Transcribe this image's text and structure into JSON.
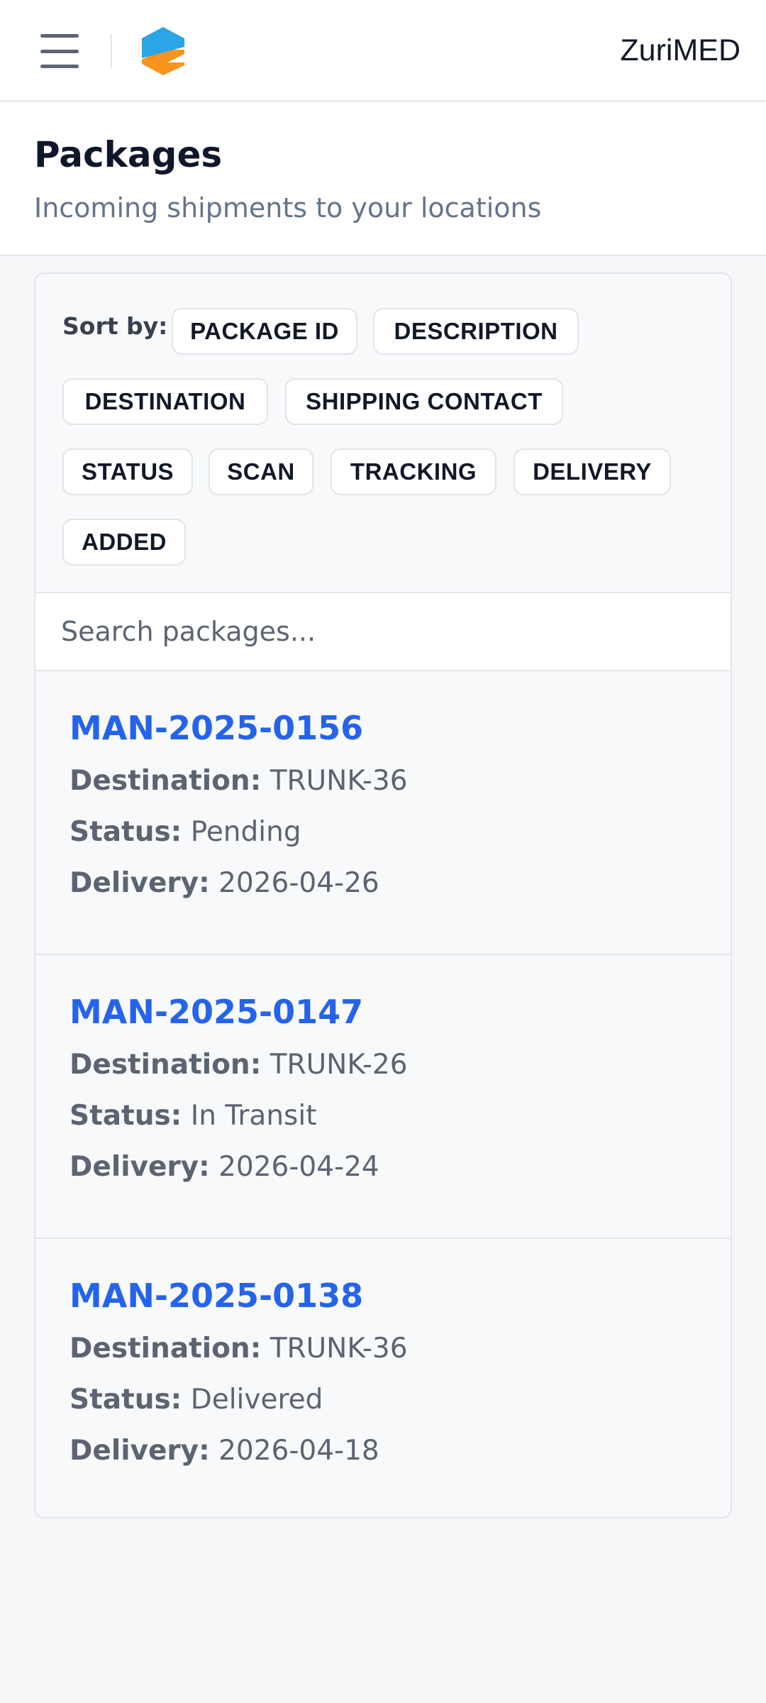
{
  "header": {
    "menu_icon": "hamburger-menu-icon",
    "logo_icon": "zurimed-logo-icon",
    "brand": "ZuriMED",
    "colors": {
      "logo_blue": "#2aa6e8",
      "logo_orange": "#f7941d"
    }
  },
  "page": {
    "title": "Packages",
    "subtitle": "Incoming shipments to your locations"
  },
  "sort": {
    "label": "Sort by:",
    "options": [
      "PACKAGE ID",
      "DESCRIPTION",
      "DESTINATION",
      "SHIPPING CONTACT",
      "STATUS",
      "SCAN",
      "TRACKING",
      "DELIVERY",
      "ADDED"
    ]
  },
  "search": {
    "placeholder": "Search packages...",
    "value": ""
  },
  "field_labels": {
    "destination": "Destination:",
    "status": "Status:",
    "delivery": "Delivery:"
  },
  "packages": [
    {
      "id": "MAN-2025-0156",
      "destination": "TRUNK-36",
      "status": "Pending",
      "delivery": "2026-04-26"
    },
    {
      "id": "MAN-2025-0147",
      "destination": "TRUNK-26",
      "status": "In Transit",
      "delivery": "2026-04-24"
    },
    {
      "id": "MAN-2025-0138",
      "destination": "TRUNK-36",
      "status": "Delivered",
      "delivery": "2026-04-18"
    }
  ],
  "colors": {
    "link": "#2563eb",
    "muted": "#5b6472"
  }
}
